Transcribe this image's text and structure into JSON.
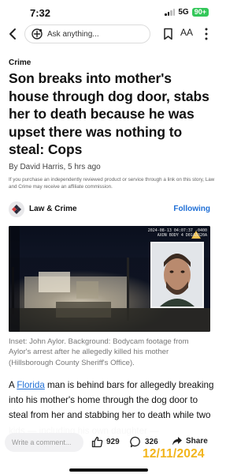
{
  "status_bar": {
    "time": "7:32",
    "network": "5G",
    "battery": "90+"
  },
  "nav": {
    "search_placeholder": "Ask anything...",
    "text_size_label": "AA"
  },
  "article": {
    "section": "Crime",
    "headline": "Son breaks into mother's house through dog door, stabs her to death because he was upset there was nothing to steal: Cops",
    "byline": "By David Harris, 5 hrs ago",
    "disclaimer": "If you purchase an independently reviewed product or service through a link on this story, Law and Crime may receive an affiliate commission.",
    "publisher": {
      "name": "Law & Crime",
      "follow_label": "Following"
    },
    "hero_image": {
      "camera_timestamp": "2024-08-13 04:07:37 -0400",
      "camera_device": "AXON BODY 4 D01A3320A"
    },
    "caption": "Inset: John Aylor. Background: Bodycam footage from Aylor's arrest after he allegedly killed his mother (Hillsborough County Sheriff's Office).",
    "body": {
      "prefix": "A ",
      "link_text": "Florida",
      "text": " man is behind bars for allegedly breaking into his mother's home through the dog door to steal from her and stabbing her to death while two kids — including his own daughter —"
    }
  },
  "bottom_bar": {
    "comment_placeholder": "Write a comment...",
    "likes": "929",
    "comments": "326",
    "share_label": "Share",
    "date_stamp": "12/11/2024"
  },
  "colors": {
    "link_blue": "#1f6fd6",
    "battery_green": "#33c759",
    "date_stamp_yellow": "#f2b51c"
  },
  "icons": [
    "back-arrow-icon",
    "copilot-icon",
    "bookmark-icon",
    "more-vertical-icon",
    "law-and-crime-logo-icon",
    "thumbs-up-icon",
    "comment-icon",
    "share-arrow-icon"
  ]
}
